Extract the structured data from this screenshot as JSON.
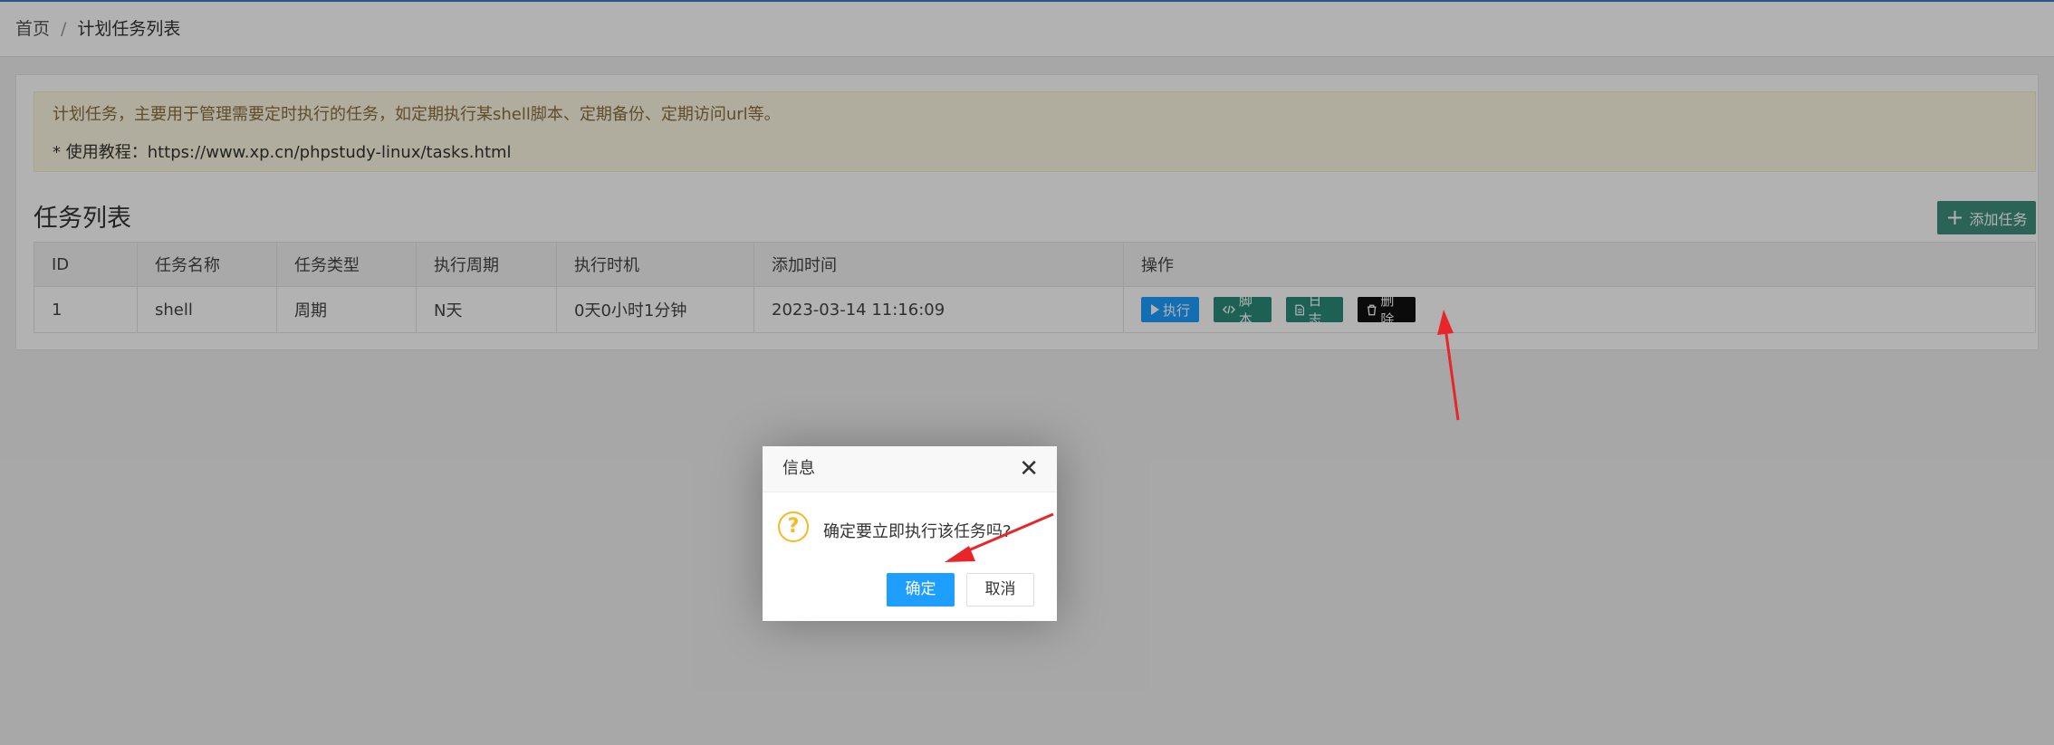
{
  "breadcrumb": {
    "home": "首页",
    "separator": "/",
    "current": "计划任务列表"
  },
  "notice": {
    "line1": "计划任务，主要用于管理需要定时执行的任务，如定期执行某shell脚本、定期备份、定期访问url等。",
    "line2": "* 使用教程：https://www.xp.cn/phpstudy-linux/tasks.html"
  },
  "section_title": "任务列表",
  "add_button": {
    "icon": "plus-icon",
    "label": "添加任务"
  },
  "table": {
    "columns": [
      "ID",
      "任务名称",
      "任务类型",
      "执行周期",
      "执行时机",
      "添加时间",
      "操作"
    ],
    "rows": [
      {
        "id": "1",
        "name": "shell",
        "type": "周期",
        "cycle": "N天",
        "timing": "0天0小时1分钟",
        "added": "2023-03-14 11:16:09"
      }
    ],
    "actions": {
      "run": {
        "icon": "play-icon",
        "label": "执行"
      },
      "script": {
        "icon": "code-icon",
        "label": "脚本"
      },
      "log": {
        "icon": "file-icon",
        "label": "日志"
      },
      "delete": {
        "icon": "trash-icon",
        "label": "删除"
      }
    }
  },
  "dialog": {
    "title": "信息",
    "close_icon": "close-icon",
    "question_icon": "question-icon",
    "message": "确定要立即执行该任务吗?",
    "confirm": "确定",
    "cancel": "取消"
  },
  "colors": {
    "primary": "#1e9fff",
    "teal": "#2a8c7a",
    "arrow": "#e8262a",
    "notice_bg": "#fcf8e3"
  }
}
